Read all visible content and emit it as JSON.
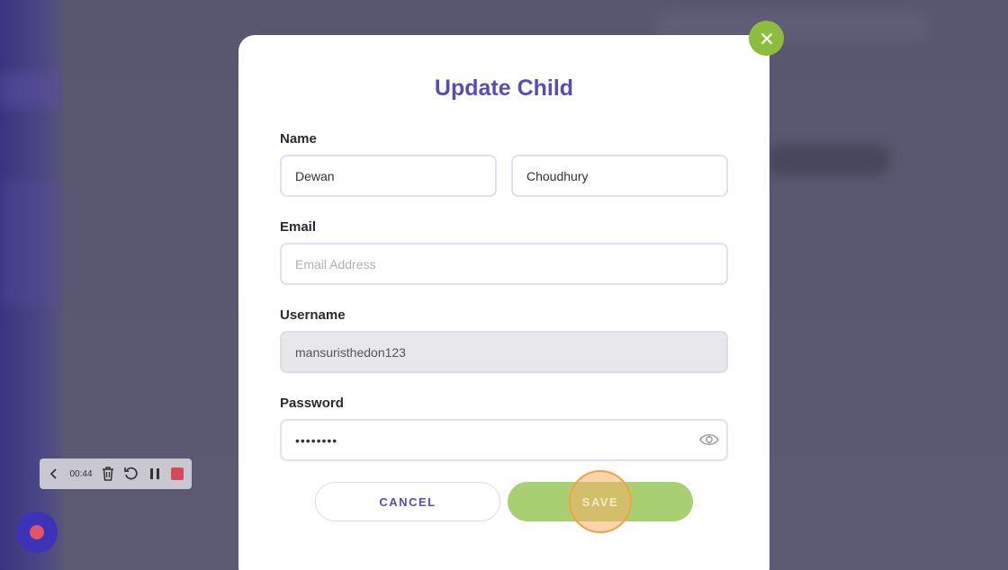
{
  "modal": {
    "title": "Update Child",
    "name_label": "Name",
    "first_name_value": "Dewan",
    "last_name_value": "Choudhury",
    "email_label": "Email",
    "email_placeholder": "Email Address",
    "username_label": "Username",
    "username_value": "mansuristhedon123",
    "password_label": "Password",
    "password_value": "••••••••",
    "cancel_label": "CANCEL",
    "save_label": "SAVE"
  },
  "recorder": {
    "time": "00:44"
  },
  "colors": {
    "accent": "#5b4bb7",
    "close_button": "#8cbd3d",
    "save_button": "#a9cf73",
    "record_stop": "#d34a5b"
  },
  "icons": {
    "close": "close-icon",
    "eye": "eye-icon",
    "back": "chevron-left-icon",
    "trash": "trash-icon",
    "restart": "restart-icon",
    "pause": "pause-icon",
    "stop": "stop-icon"
  }
}
